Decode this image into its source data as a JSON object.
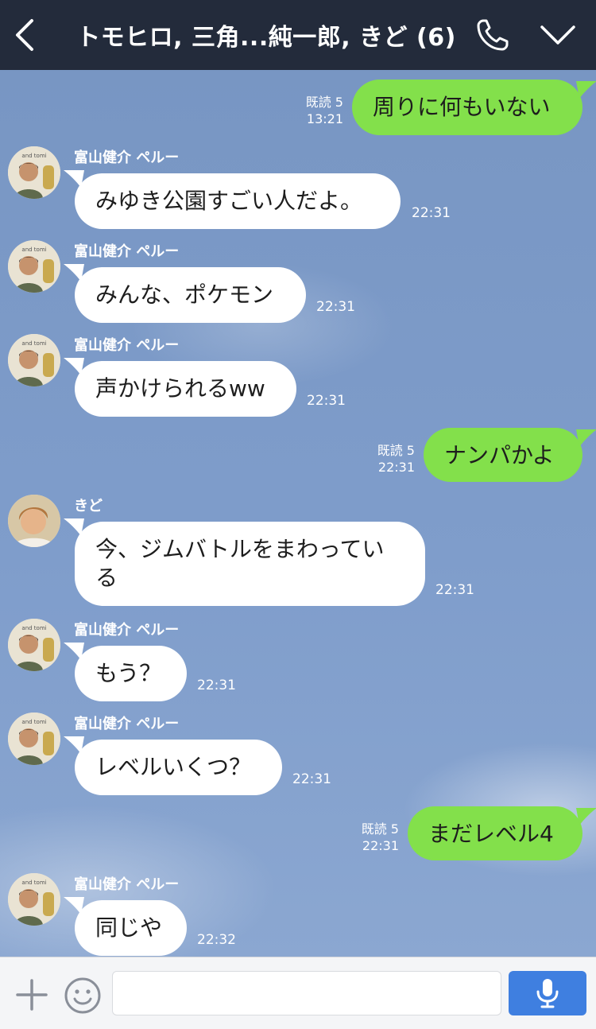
{
  "header": {
    "title": "トモヒロ, 三角...純一郎, きど (6)"
  },
  "messages": [
    {
      "dir": "out",
      "text": "周りに何もいない",
      "read": "既読 5",
      "time": "13:21"
    },
    {
      "dir": "in",
      "sender": "富山健介 ペルー",
      "text": "みゆき公園すごい人だよ。",
      "time": "22:31",
      "avatar": "tomiyama"
    },
    {
      "dir": "in",
      "sender": "富山健介 ペルー",
      "text": "みんな、ポケモン",
      "time": "22:31",
      "avatar": "tomiyama"
    },
    {
      "dir": "in",
      "sender": "富山健介 ペルー",
      "text": "声かけられるww",
      "time": "22:31",
      "avatar": "tomiyama"
    },
    {
      "dir": "out",
      "text": "ナンパかよ",
      "read": "既読 5",
      "time": "22:31"
    },
    {
      "dir": "in",
      "sender": "きど",
      "text_line1": "今、ジムバトルをまわってい",
      "text_line2": "る",
      "time": "22:31",
      "avatar": "kido"
    },
    {
      "dir": "in",
      "sender": "富山健介 ペルー",
      "text": "もう？",
      "time": "22:31",
      "avatar": "tomiyama"
    },
    {
      "dir": "in",
      "sender": "富山健介 ペルー",
      "text": "レベルいくつ？",
      "time": "22:31",
      "avatar": "tomiyama"
    },
    {
      "dir": "out",
      "text": "まだレベル4",
      "read": "既読 5",
      "time": "22:31"
    },
    {
      "dir": "in",
      "sender": "富山健介 ペルー",
      "text": "同じや",
      "time": "22:32",
      "avatar": "tomiyama"
    }
  ],
  "input": {
    "placeholder": ""
  },
  "colors": {
    "header_bg": "#232b3b",
    "out_bubble": "#83e04b",
    "in_bubble": "#ffffff",
    "mic_button": "#3f7fe0"
  },
  "icons": {
    "back": "chevron-left-icon",
    "call": "phone-icon",
    "menu": "chevron-down-icon",
    "plus": "plus-icon",
    "sticker": "smiley-icon",
    "mic": "microphone-icon"
  }
}
